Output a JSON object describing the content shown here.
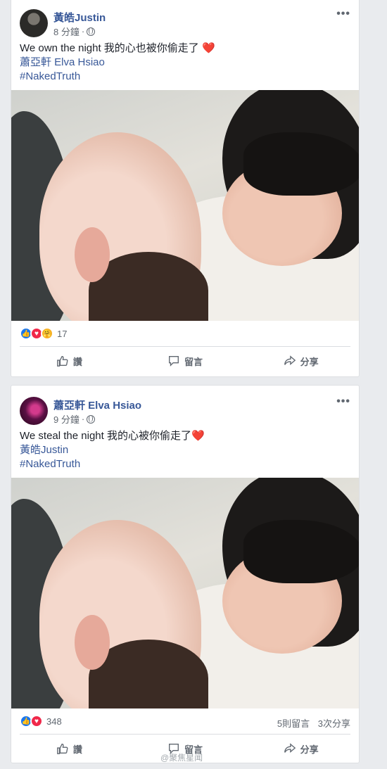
{
  "posts": [
    {
      "author": "黃皓Justin",
      "time": "8 分鐘",
      "separator": "·",
      "more": "•••",
      "text_line1": "We own the night 我的心也被你偷走了",
      "heart": "❤️",
      "mention": "蕭亞軒 Elva Hsiao",
      "hashtag": "#NakedTruth",
      "reactions": [
        "like",
        "love",
        "care"
      ],
      "reaction_count": "17",
      "comments": "",
      "shares": "",
      "actions": {
        "like": "讚",
        "comment": "留言",
        "share": "分享"
      }
    },
    {
      "author": "蕭亞軒 Elva Hsiao",
      "time": "9 分鐘",
      "separator": "·",
      "more": "•••",
      "text_line1": "We steal the night 我的心被你偷走了",
      "heart": "❤️",
      "mention": "黃皓Justin",
      "hashtag": "#NakedTruth",
      "reactions": [
        "like",
        "love"
      ],
      "reaction_count": "348",
      "comments": "5則留言",
      "shares": "3次分享",
      "actions": {
        "like": "讚",
        "comment": "留言",
        "share": "分享"
      }
    }
  ],
  "colors": {
    "link": "#385898",
    "like": "#1877f2",
    "love": "#f0284a",
    "care": "#f7b125"
  },
  "watermark": "@聚焦星闻"
}
